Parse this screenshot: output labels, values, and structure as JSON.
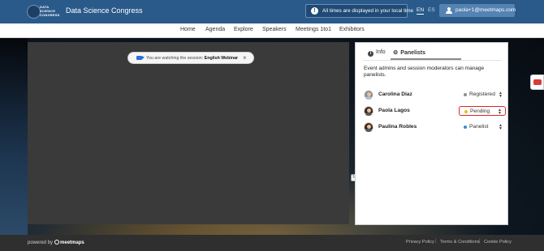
{
  "header": {
    "logo_text": "DATA SCIENCE CONGRESS",
    "title": "Data Science Congress",
    "timezone_notice": "All times are displayed in your local time",
    "languages": [
      "EN",
      "ES"
    ],
    "active_language": "EN",
    "user_email": "paola+1@meetmaps.com"
  },
  "nav": {
    "items": [
      "Home",
      "Agenda",
      "Explore",
      "Speakers",
      "Meetings 1to1",
      "Exhibitors"
    ]
  },
  "session": {
    "watching_prefix": "You are watching the session:",
    "session_name": "English Webinar",
    "close_symbol": "×"
  },
  "panel": {
    "tabs": [
      "Info",
      "Panelists"
    ],
    "active_tab": "Panelists",
    "description": "Event admins and session moderators can manage panelists.",
    "panelists": [
      {
        "name": "Carolina Diaz",
        "status": "Registered",
        "status_color": "#8c8c8c"
      },
      {
        "name": "Paola Lagos",
        "status": "Pending",
        "status_color": "#e0c020"
      },
      {
        "name": "Paulina Robles",
        "status": "Panelist",
        "status_color": "#2c8fd6"
      }
    ],
    "highlighted_status": "Pending"
  },
  "footer": {
    "powered_by": "powered by",
    "brand": "meetmaps",
    "links": [
      "Privacy Policy",
      "Terms & Conditions",
      "Cookie Policy"
    ]
  },
  "colors": {
    "header_bg": "#2a5a8a",
    "accent": "#5482b2",
    "highlight_border": "#e02424"
  },
  "icons": {
    "info_tab": "info-icon",
    "panelists_tab": "cog-icon",
    "session": "video-camera-icon",
    "timezone": "clock-icon",
    "user": "user-icon"
  }
}
